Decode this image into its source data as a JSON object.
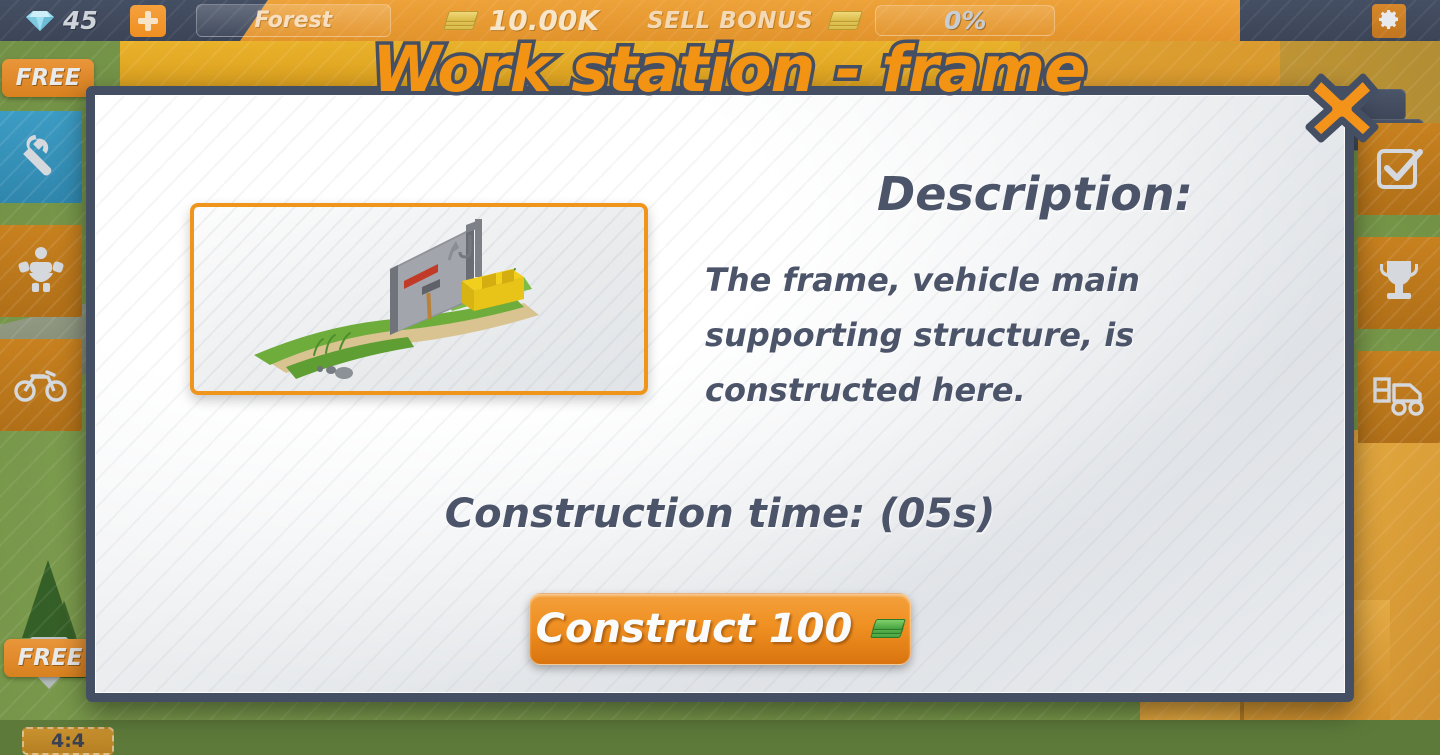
{
  "topbar": {
    "gem_icon": "diamond-icon",
    "gem_count": "45",
    "add_gems_label": "+",
    "zone_name": "Forest",
    "money_icon": "cash-stack-icon",
    "money_value": "10.00K",
    "sell_bonus_label": "SELL BONUS",
    "sell_bonus_icon": "cash-stack-icon",
    "sell_bonus_value": "0%",
    "settings_icon": "gear-icon"
  },
  "sidebar_left": {
    "free_label": "FREE",
    "free_label_2": "FREE",
    "timer": "4:4",
    "items": [
      {
        "icon": "wrench-icon",
        "color": "#3d9cc4"
      },
      {
        "icon": "handshake-icon",
        "color": "#c8811f"
      },
      {
        "icon": "motorcycle-icon",
        "color": "#c8811f"
      }
    ]
  },
  "sidebar_right": {
    "items": [
      {
        "icon": "checkbox-tasks-icon",
        "color": "#c8811f"
      },
      {
        "icon": "trophy-icon",
        "color": "#c8811f"
      },
      {
        "icon": "forklift-truck-icon",
        "color": "#c8811f"
      }
    ]
  },
  "dialog": {
    "title": "Work station - frame",
    "close_icon": "close-x-icon",
    "thumbnail_name": "work-station-frame-preview",
    "description_heading": "Description:",
    "description_text": "The frame, vehicle main supporting structure, is constructed here.",
    "construction_time": "Construction time: (05s)",
    "construct_button_label": "Construct 100",
    "construct_button_icon": "cash-stack-icon"
  },
  "colors": {
    "accent_orange": "#f0951b",
    "panel_border": "#454f63",
    "text_slate": "#4b5469",
    "tile_orange": "#c8811f",
    "tile_blue": "#3d9cc4"
  }
}
